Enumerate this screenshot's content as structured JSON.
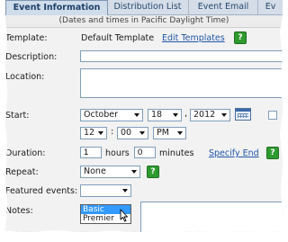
{
  "tabs": [
    "Event Information",
    "Distribution List",
    "Event Email",
    "Ev"
  ],
  "tz_note": "(Dates and times in Pacific Daylight Time)",
  "template": {
    "label": "Template:",
    "value": "Default Template",
    "edit_link": "Edit Templates"
  },
  "description": {
    "label": "Description:",
    "value": ""
  },
  "location": {
    "label": "Location:",
    "value": ""
  },
  "start": {
    "label": "Start:",
    "month": "October",
    "day": "18",
    "comma": ",",
    "year": "2012",
    "hour": "12",
    "colon": ":",
    "minute": "00",
    "ampm": "PM"
  },
  "duration": {
    "label": "Duration:",
    "hours_value": "1",
    "hours_unit": "hours",
    "minutes_value": "0",
    "minutes_unit": "minutes",
    "specify_end": "Specify End"
  },
  "repeat": {
    "label": "Repeat:",
    "value": "None"
  },
  "featured": {
    "label": "Featured events:",
    "value": "",
    "options": [
      "Basic",
      "Premier"
    ]
  },
  "notes": {
    "label": "Notes:"
  },
  "help_glyph": "?",
  "colors": {
    "tab_bg": "#d4dde8",
    "link": "#1f55a8",
    "help_green": "#2f9a2f",
    "highlight": "#3399ff"
  }
}
